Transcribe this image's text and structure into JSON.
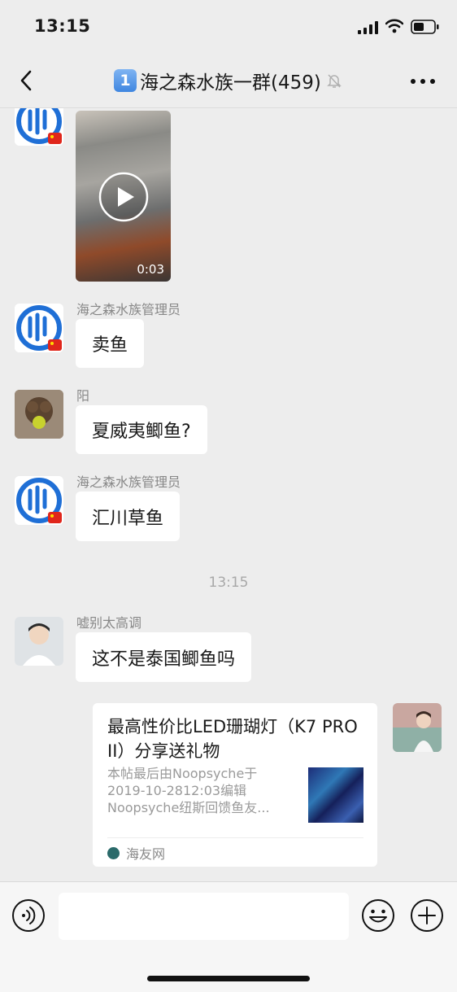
{
  "status_bar": {
    "time": "13:15"
  },
  "nav": {
    "badge": "1",
    "title": "海之森水族一群(459)"
  },
  "messages": [
    {
      "kind": "video",
      "duration": "0:03"
    },
    {
      "sender": "海之森水族管理员",
      "text": "卖鱼"
    },
    {
      "sender": "阳",
      "text": "夏威夷鲫鱼?"
    },
    {
      "sender": "海之森水族管理员",
      "text": "汇川草鱼"
    },
    {
      "timestamp": "13:15"
    },
    {
      "sender": "嘘别太高调",
      "text": "这不是泰国鲫鱼吗"
    }
  ],
  "card": {
    "title": "最高性价比LED珊瑚灯（K7 PRO II）分享送礼物",
    "desc": "本帖最后由Noopsyche于\n2019-10-2812:03编辑\nNoopsyche纽斯回馈鱼友...",
    "source": "海友网"
  },
  "input": {
    "placeholder": ""
  },
  "colors": {
    "background": "#ededed",
    "bubble": "#ffffff",
    "logo_blue": "#1f6fd6"
  }
}
